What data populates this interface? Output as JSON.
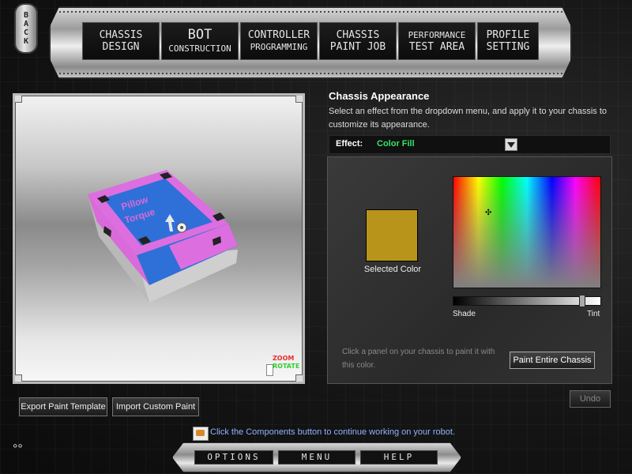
{
  "back": {
    "label": "BACK"
  },
  "nav": {
    "tabs": [
      {
        "line1": "CHASSIS",
        "line2": "DESIGN"
      },
      {
        "line1": "BOT",
        "line2": "CONSTRUCTION"
      },
      {
        "line1": "CONTROLLER",
        "line2": "PROGRAMMING"
      },
      {
        "line1": "CHASSIS",
        "line2": "PAINT JOB"
      },
      {
        "line1": "PERFORMANCE",
        "line2": "TEST AREA"
      },
      {
        "line1": "PROFILE",
        "line2": "SETTING"
      }
    ]
  },
  "viewport": {
    "robot_label_line1": "Pillow",
    "robot_label_line2": "Torque",
    "zoom_label": "ZOOM",
    "rotate_label": "ROTATE"
  },
  "panel": {
    "title": "Chassis Appearance",
    "description": "Select an effect from the dropdown menu, and apply it to your chassis to customize its appearance.",
    "effect_label": "Effect:",
    "effect_value": "Color Fill",
    "selected_color_label": "Selected Color",
    "selected_color": "#b8941a",
    "shade_label": "Shade",
    "tint_label": "Tint",
    "shade_level": 0.9,
    "hint": "Click a panel on your chassis to paint it with this color.",
    "paint_button": "Paint Entire Chassis",
    "undo_button": "Undo"
  },
  "bottom": {
    "export_button": "Export Paint Template",
    "import_button": "Import Custom Paint",
    "status_text": "Click the Components button to continue working on your robot.",
    "options": "OPTIONS",
    "menu": "MENU",
    "help": "HELP"
  },
  "colors": {
    "chassis_pink": "#dd6ee0",
    "chassis_blue": "#2f6fd8",
    "accent_green": "#36e36a",
    "status_blue": "#8fb3ff"
  }
}
